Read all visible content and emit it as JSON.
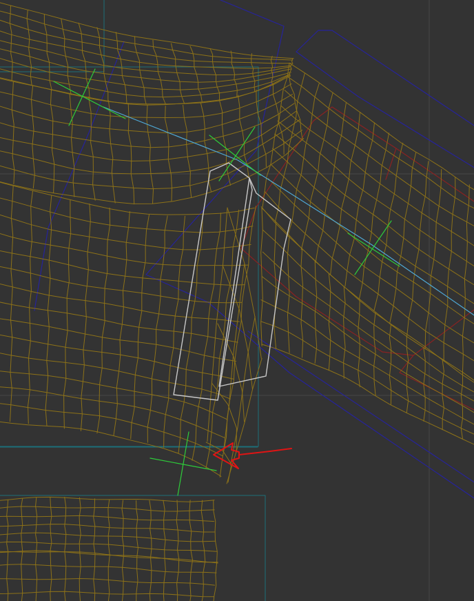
{
  "viewport": {
    "background": "#333333",
    "grid_color": "#474747",
    "colors": {
      "mesh_wireframe": "#8d7218",
      "bone_axis": "#4fa9d6",
      "bone_envelope": "#c8c8c8",
      "helper_box": "#26239b",
      "bounding_box": "#1c6f7a",
      "selection_box": "#8a2222",
      "pivot_cross": "#2ecc3a",
      "annotation_arrow": "#e01414"
    },
    "icons": [
      "red-arrow-annotation-icon",
      "pivot-cross-icon"
    ]
  }
}
